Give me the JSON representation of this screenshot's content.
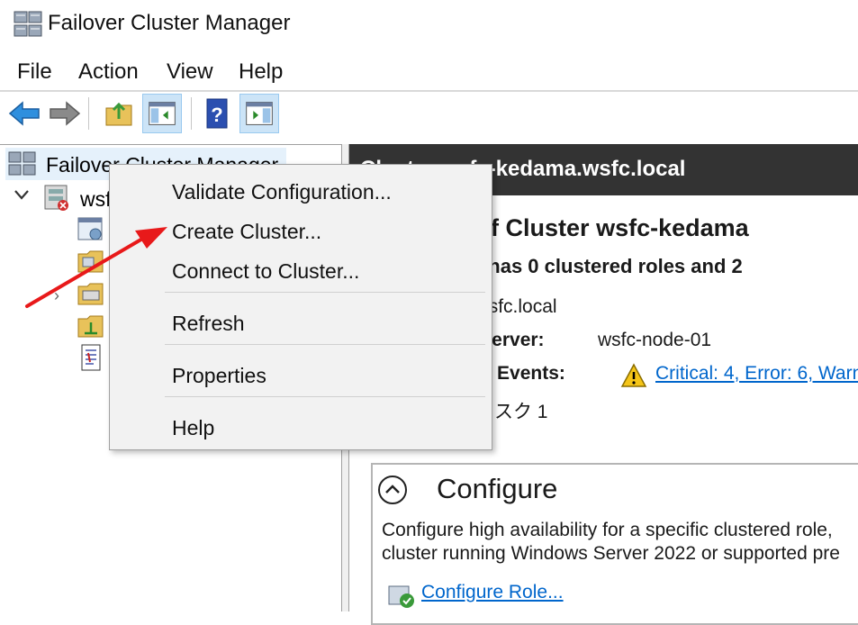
{
  "window": {
    "title": "Failover Cluster Manager"
  },
  "menubar": {
    "items": [
      "File",
      "Action",
      "View",
      "Help"
    ]
  },
  "toolbar": {
    "buttons": [
      "back-icon",
      "forward-icon",
      "up-folder-icon",
      "show-hide-console-tree-icon",
      "help-icon",
      "show-hide-action-pane-icon"
    ]
  },
  "tree": {
    "root_label": "Failover Cluster Manager",
    "cluster_label": "wsfc"
  },
  "context_menu": {
    "items": [
      "Validate Configuration...",
      "Create Cluster...",
      "Connect to Cluster...",
      "Refresh",
      "Properties",
      "Help"
    ]
  },
  "right_pane": {
    "header": "Cluster wsfc-kedama.wsfc.local",
    "summary_title": "Summary of Cluster wsfc-kedama",
    "summary_subtitle": "wsfc-kedama has 0 clustered roles and 2",
    "cluster_name": "wsfc-kedama.wsfc.local",
    "host_label": "Current Host Server:",
    "host_value": "wsfc-node-01",
    "events_label": "Recent Cluster Events:",
    "events_link": "Critical: 4, Error: 6, Warn",
    "disk_text": "クラスター ディスク 1",
    "configure": {
      "title": "Configure",
      "line1": "Configure high availability for a specific clustered role,",
      "line2": "cluster running Windows Server 2022 or supported pre",
      "role_link": "Configure Role..."
    }
  },
  "colors": {
    "header_bg": "#333333",
    "link": "#0066cc",
    "arrow": "#e8191a",
    "selection": "#e5f1fb"
  }
}
